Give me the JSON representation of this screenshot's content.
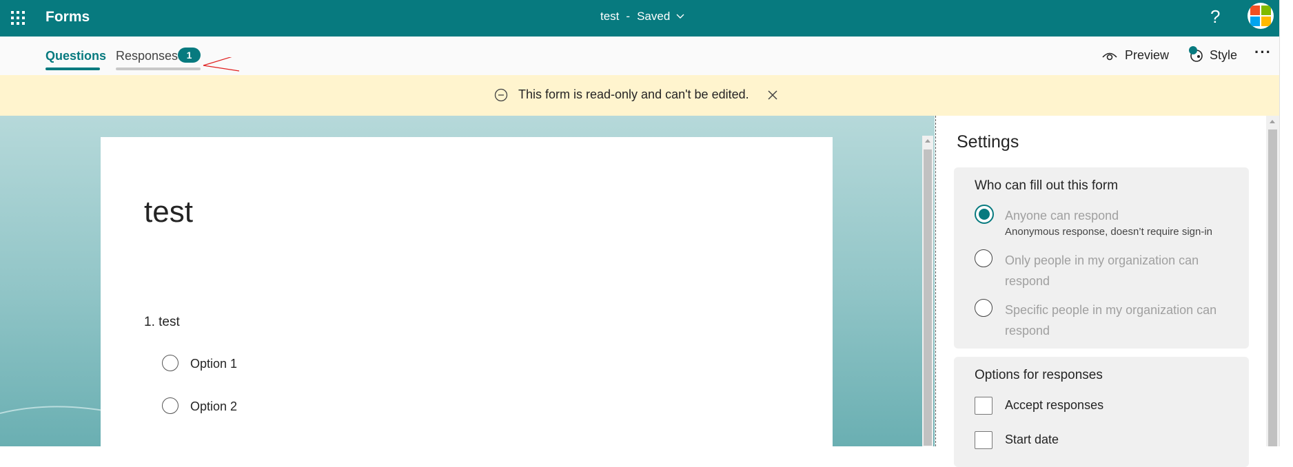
{
  "app": {
    "name": "Forms",
    "doc_title": "test",
    "separator": "-",
    "save_status": "Saved",
    "help": "?"
  },
  "tabs": {
    "questions": "Questions",
    "responses": "Responses",
    "responses_count": "1"
  },
  "actions": {
    "preview": "Preview",
    "style": "Style",
    "more": "···"
  },
  "banner": {
    "text": "This form is read-only and can't be edited."
  },
  "form": {
    "title": "test",
    "question": "1. test",
    "options": [
      "Option 1",
      "Option 2"
    ]
  },
  "settings": {
    "title": "Settings",
    "who_heading": "Who can fill out this form",
    "who_options": [
      {
        "label": "Anyone can respond",
        "sub": "Anonymous response, doesn’t require sign-in",
        "selected": true
      },
      {
        "label": "Only people in my organization can respond",
        "selected": false
      },
      {
        "label": "Specific people in my organization can respond",
        "selected": false
      }
    ],
    "responses_heading": "Options for responses",
    "response_options": [
      "Accept responses",
      "Start date"
    ]
  },
  "colors": {
    "brand": "#077a7f",
    "banner": "#fff4ce",
    "annotation_arrow": "#e02020"
  },
  "icons": [
    "waffle-icon",
    "chevron-down-icon",
    "help-icon",
    "microsoft-logo",
    "eye-icon",
    "palette-icon",
    "more-icon",
    "minus-circle-icon",
    "close-icon"
  ]
}
